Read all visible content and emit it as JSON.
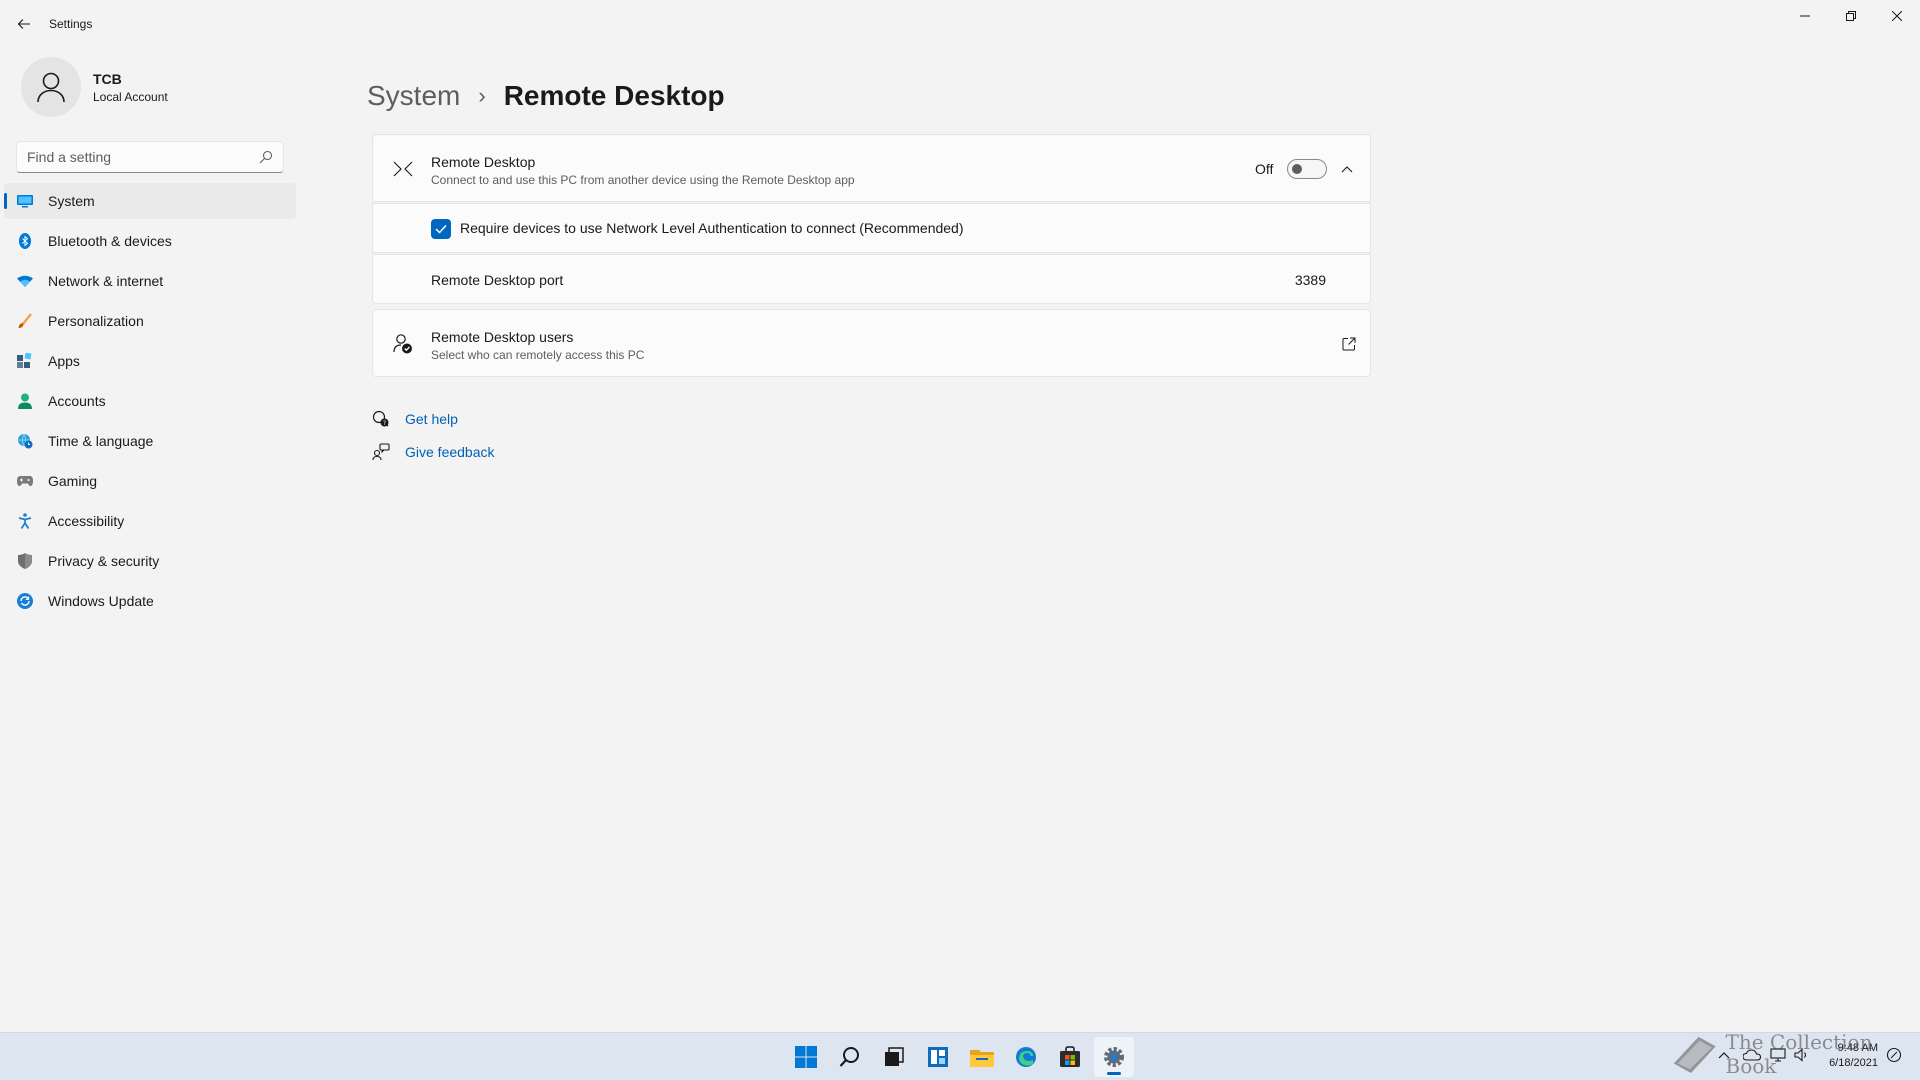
{
  "window": {
    "title": "Settings"
  },
  "profile": {
    "name": "TCB",
    "account_type": "Local Account"
  },
  "search": {
    "placeholder": "Find a setting",
    "value": ""
  },
  "sidebar": {
    "items": [
      {
        "label": "System",
        "icon": "monitor-icon",
        "active": true
      },
      {
        "label": "Bluetooth & devices",
        "icon": "bluetooth-icon"
      },
      {
        "label": "Network & internet",
        "icon": "wifi-icon"
      },
      {
        "label": "Personalization",
        "icon": "brush-icon"
      },
      {
        "label": "Apps",
        "icon": "apps-icon"
      },
      {
        "label": "Accounts",
        "icon": "person-icon"
      },
      {
        "label": "Time & language",
        "icon": "globe-clock-icon"
      },
      {
        "label": "Gaming",
        "icon": "gamepad-icon"
      },
      {
        "label": "Accessibility",
        "icon": "accessibility-icon"
      },
      {
        "label": "Privacy & security",
        "icon": "shield-icon"
      },
      {
        "label": "Windows Update",
        "icon": "update-icon"
      }
    ]
  },
  "breadcrumb": {
    "parent": "System",
    "separator": "›",
    "current": "Remote Desktop"
  },
  "remote_desktop": {
    "title": "Remote Desktop",
    "description": "Connect to and use this PC from another device using the Remote Desktop app",
    "toggle_label": "Off",
    "toggle_on": false,
    "nla_label": "Require devices to use Network Level Authentication to connect (Recommended)",
    "nla_checked": true,
    "port_label": "Remote Desktop port",
    "port_value": "3389"
  },
  "users": {
    "title": "Remote Desktop users",
    "description": "Select who can remotely access this PC"
  },
  "links": {
    "help": "Get help",
    "feedback": "Give feedback"
  },
  "taskbar": {
    "apps": [
      "start-icon",
      "search-icon",
      "task-view-icon",
      "widgets-icon",
      "file-explorer-icon",
      "edge-icon",
      "store-icon",
      "settings-icon"
    ],
    "time": "9:48 AM",
    "date": "6/18/2021"
  },
  "watermark": "The Collection Book",
  "colors": {
    "accent": "#0067c0",
    "link": "#0060b8",
    "background": "#f3f3f3",
    "card": "#fbfbfb"
  }
}
